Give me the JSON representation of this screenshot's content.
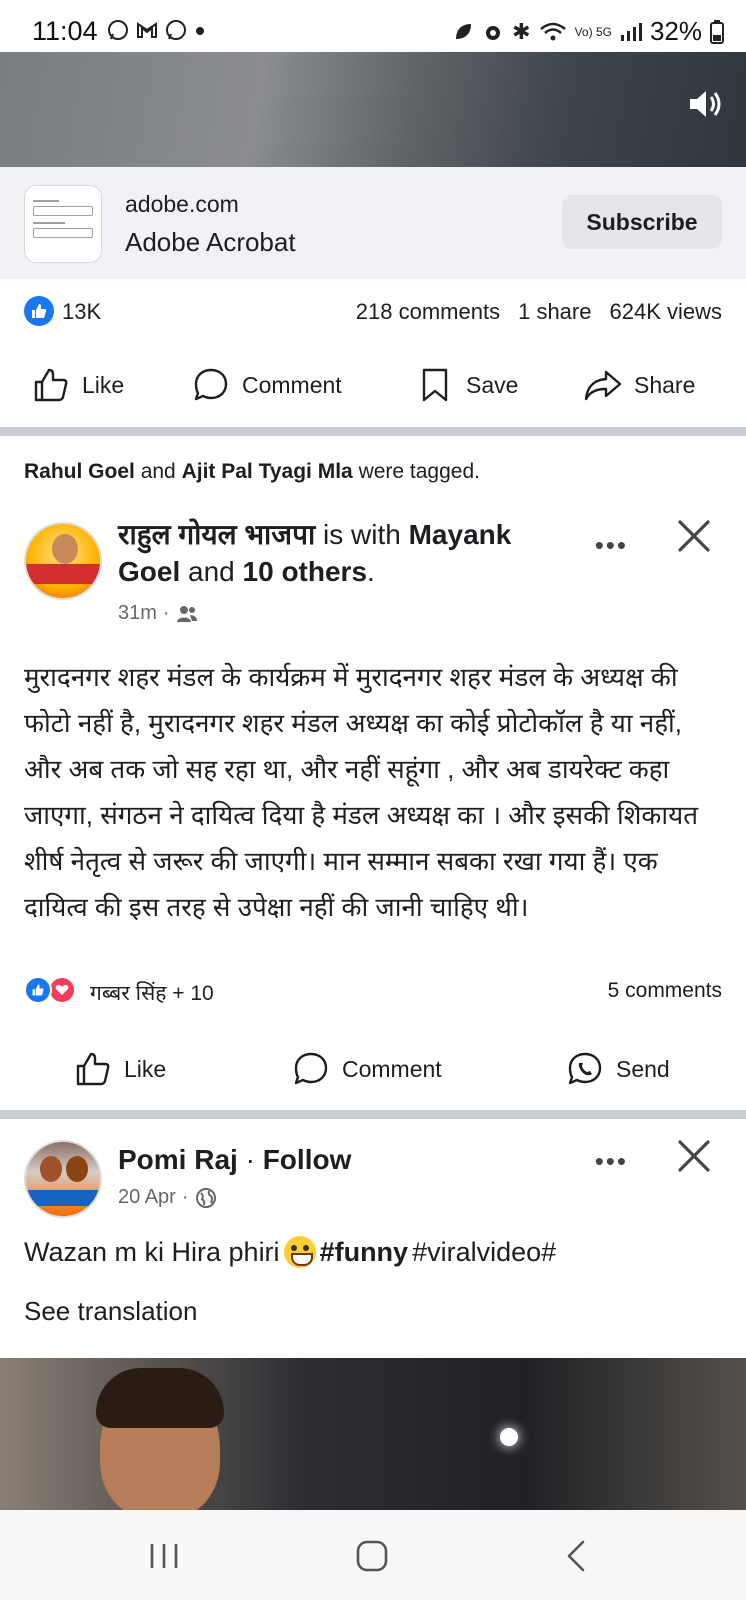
{
  "status_bar": {
    "time": "11:04",
    "battery": "32%",
    "network": "Vo) 5G"
  },
  "ad": {
    "domain": "adobe.com",
    "name": "Adobe Acrobat",
    "subscribe_label": "Subscribe"
  },
  "stats": {
    "likes": "13K",
    "comments": "218 comments",
    "shares": "1 share",
    "views": "624K views"
  },
  "actions1": {
    "like": "Like",
    "comment": "Comment",
    "save": "Save",
    "share": "Share"
  },
  "tagged": {
    "person1": "Rahul Goel",
    "and": " and ",
    "person2": "Ajit Pal Tyagi Mla",
    "suffix": " were tagged."
  },
  "post1": {
    "author": "राहुल गोयल भाजपा",
    "with_text": " is with ",
    "with_name": "Mayank Goel",
    "and_text": " and ",
    "others": "10 others",
    "period": ".",
    "time": "31m",
    "body": "मुरादनगर शहर मंडल के कार्यक्रम में मुरादनगर शहर मंडल के अध्यक्ष की फोटो नहीं है, मुरादनगर शहर मंडल अध्यक्ष का कोई प्रोटोकॉल है या नहीं, और अब तक जो सह रहा था, और नहीं सहूंगा  , और अब डायरेक्ट कहा जाएगा, संगठन ने दायित्व दिया है मंडल अध्यक्ष का । और इसकी शिकायत शीर्ष नेतृत्व से जरूर की जाएगी। मान सम्मान सबका रखा गया हैं। एक दायित्व की इस तरह से उपेक्षा नहीं की जानी चाहिए थी।",
    "reactions_names": "गब्बर सिंह + 10",
    "comments_count": "5 comments"
  },
  "actions2": {
    "like": "Like",
    "comment": "Comment",
    "send": "Send"
  },
  "post2": {
    "author": "Pomi Raj",
    "separator": " · ",
    "follow": "Follow",
    "date": "20 Apr",
    "text_plain": "Wazan m ki Hira phiri ",
    "text_bold": "#funny",
    "text_tags": "#viralvideo#",
    "see_translation": "See translation"
  },
  "icons": {
    "speaker": "volume-icon",
    "like": "thumbs-up-icon",
    "comment": "speech-bubble-icon",
    "save": "bookmark-icon",
    "share": "share-arrow-icon",
    "send": "messenger-icon",
    "friends": "friends-icon",
    "globe": "globe-icon"
  },
  "colors": {
    "facebook_blue": "#1877f2",
    "love_red": "#f33e58",
    "divider": "#c9ccd1",
    "ad_background": "#f0f2f5"
  }
}
